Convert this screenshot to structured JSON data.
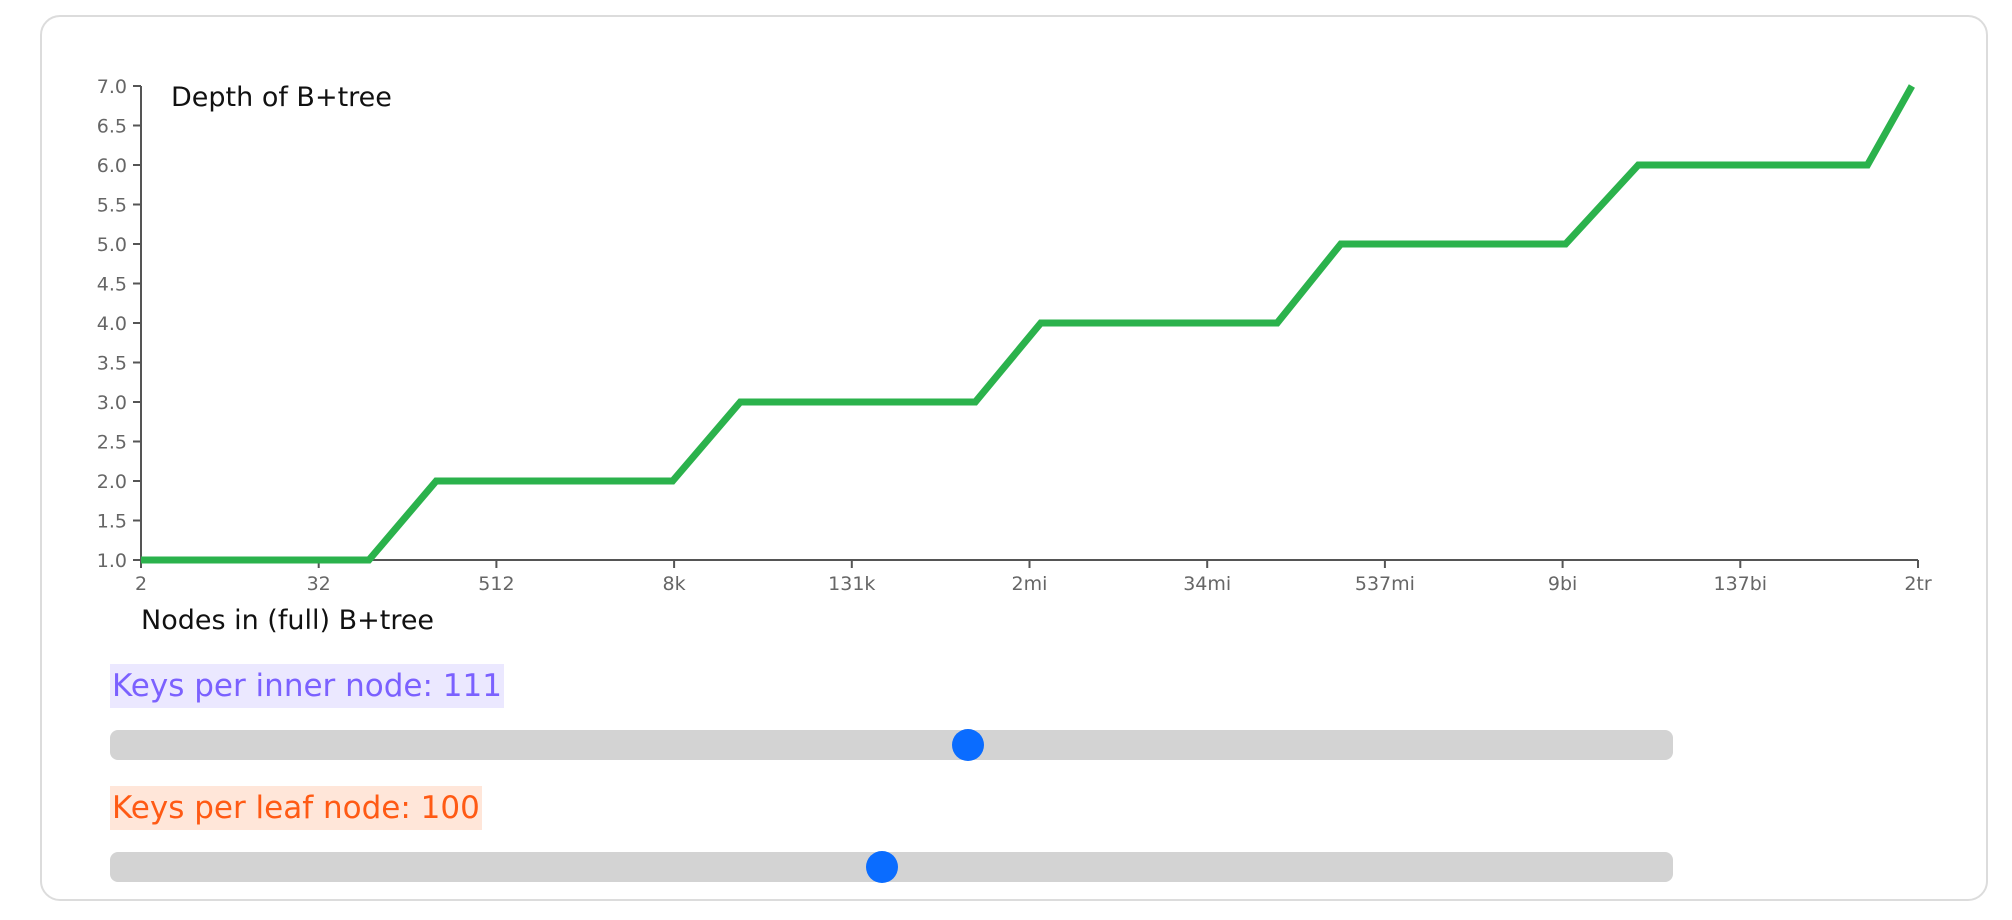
{
  "chart_data": {
    "type": "line",
    "title": "Depth of B+tree",
    "xlabel": "Nodes in (full) B+tree",
    "ylabel": "",
    "x_scale": "log2",
    "x_ticks": [
      "2",
      "32",
      "512",
      "8k",
      "131k",
      "2mi",
      "34mi",
      "537mi",
      "9bi",
      "137bi",
      "2tr"
    ],
    "y_ticks": [
      "1.0",
      "1.5",
      "2.0",
      "2.5",
      "3.0",
      "3.5",
      "4.0",
      "4.5",
      "5.0",
      "5.5",
      "6.0",
      "6.5",
      "7.0"
    ],
    "ylim": [
      1,
      7
    ],
    "series": [
      {
        "color": "#2bb24c",
        "points": [
          {
            "x": "2",
            "y": 1
          },
          {
            "x": "70",
            "y": 1
          },
          {
            "x": "200",
            "y": 2
          },
          {
            "x": "8k",
            "y": 2
          },
          {
            "x": "23k",
            "y": 3
          },
          {
            "x": "900k",
            "y": 3
          },
          {
            "x": "2.5mi",
            "y": 4
          },
          {
            "x": "100mi",
            "y": 4
          },
          {
            "x": "270mi",
            "y": 5
          },
          {
            "x": "9bi",
            "y": 5
          },
          {
            "x": "28bi",
            "y": 6
          },
          {
            "x": "1tr",
            "y": 6
          },
          {
            "x": "2tr",
            "y": 7
          }
        ]
      }
    ]
  },
  "controls": {
    "inner": {
      "label": "Keys per inner node: 111",
      "value": 111,
      "fraction": 0.549,
      "color": "#7b61ff"
    },
    "leaf": {
      "label": "Keys per leaf node: 100",
      "value": 100,
      "fraction": 0.494,
      "color": "#ff5a14"
    }
  }
}
